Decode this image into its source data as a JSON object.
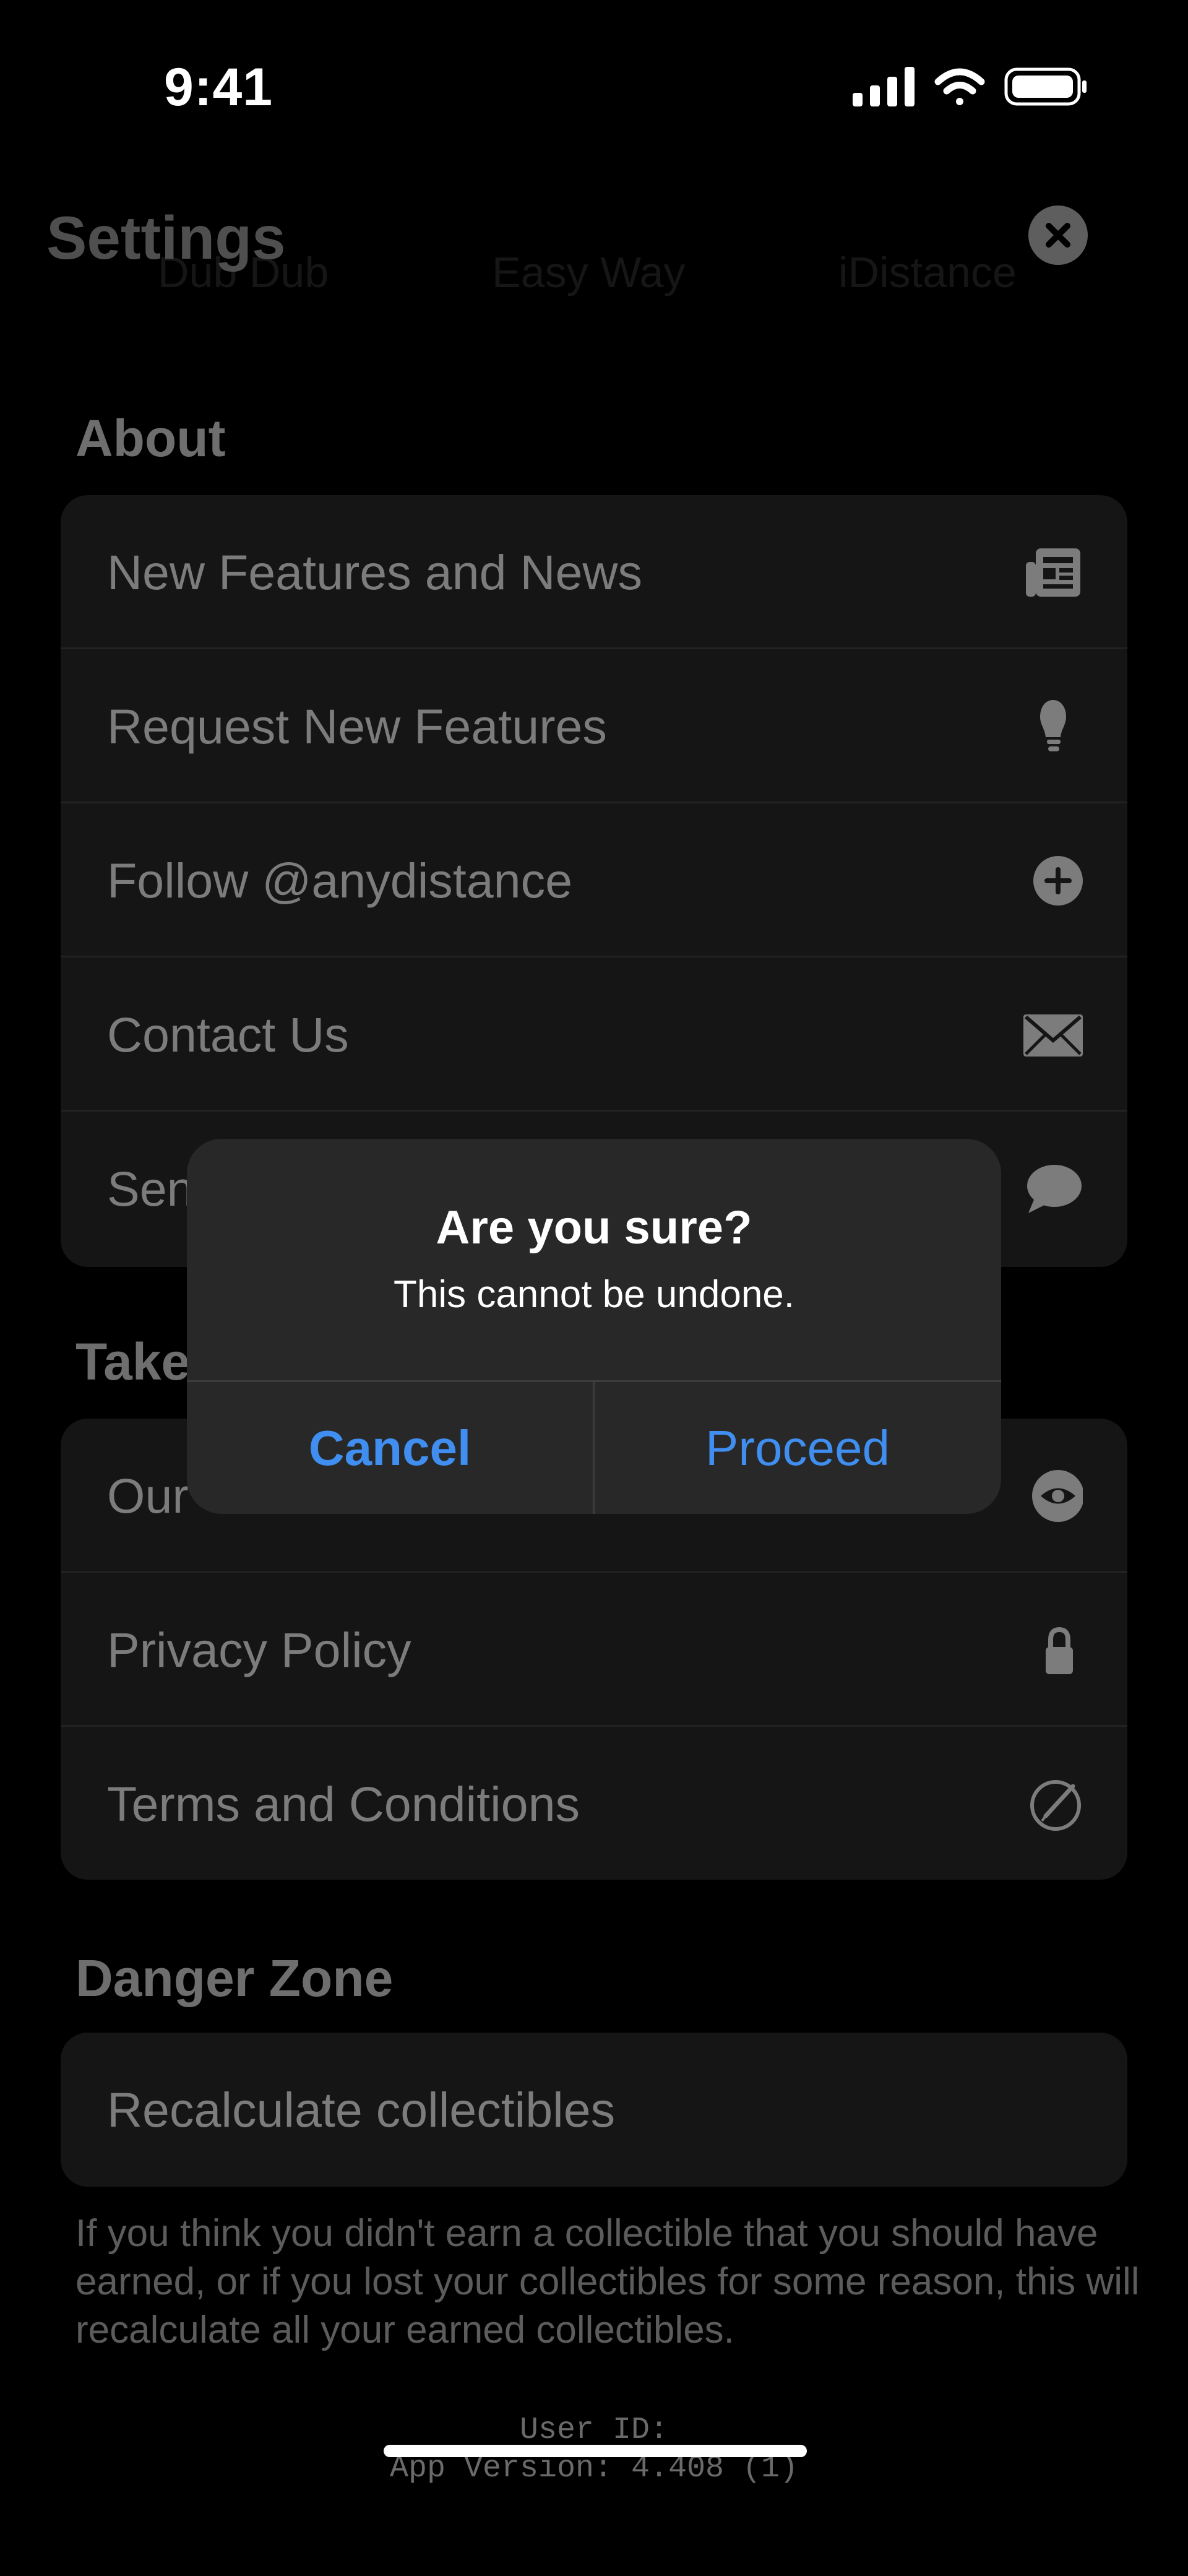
{
  "status_bar": {
    "time": "9:41"
  },
  "header": {
    "title": "Settings",
    "ghost_items": [
      "Dub Dub",
      "Easy Way",
      "iDistance"
    ]
  },
  "sections": {
    "about": {
      "title": "About",
      "items": [
        {
          "label": "New Features and News",
          "icon": "newspaper-icon"
        },
        {
          "label": "Request New Features",
          "icon": "lightbulb-icon"
        },
        {
          "label": "Follow @anydistance",
          "icon": "plus-circle-icon"
        },
        {
          "label": "Contact Us",
          "icon": "envelope-icon"
        },
        {
          "label": "Sen",
          "icon": "chat-bubble-icon"
        }
      ]
    },
    "take": {
      "title": "Take",
      "items": [
        {
          "label": "Our",
          "icon": "eye-icon"
        },
        {
          "label": "Privacy Policy",
          "icon": "lock-icon"
        },
        {
          "label": "Terms and Conditions",
          "icon": "signature-icon"
        }
      ]
    },
    "danger": {
      "title": "Danger Zone",
      "items": [
        {
          "label": "Recalculate collectibles"
        }
      ],
      "footnote": "If you think you didn't earn a collectible that you should have earned, or if you lost your collectibles for some reason, this will recalculate all your earned collectibles."
    }
  },
  "footer": {
    "user_id": "User ID:",
    "app_version": "App Version: 4.408 (1)"
  },
  "alert": {
    "title": "Are you sure?",
    "message": "This cannot be undone.",
    "cancel_label": "Cancel",
    "proceed_label": "Proceed"
  },
  "colors": {
    "background": "#000000",
    "card": "#151515",
    "alert": "#282828",
    "accent": "#3f8ef0"
  }
}
